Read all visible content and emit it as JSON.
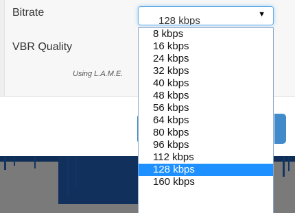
{
  "settings": {
    "bitrate_label": "Bitrate",
    "vbr_label": "VBR Quality",
    "encoder_note": "Using L.A.M.E.",
    "bitrate_selected": "128 kbps"
  },
  "dropdown": {
    "options": [
      "8 kbps",
      "16 kbps",
      "24 kbps",
      "32 kbps",
      "40 kbps",
      "48 kbps",
      "56 kbps",
      "64 kbps",
      "80 kbps",
      "96 kbps",
      "112 kbps",
      "128 kbps",
      "160 kbps"
    ],
    "selected_index": 11
  },
  "colors": {
    "accent": "#428bca",
    "highlight": "#1e90ff",
    "waveform": "#0e2e57",
    "waveform_bg": "#7a7a7a"
  },
  "icons": {
    "select_arrow": "chevron-down-icon"
  }
}
